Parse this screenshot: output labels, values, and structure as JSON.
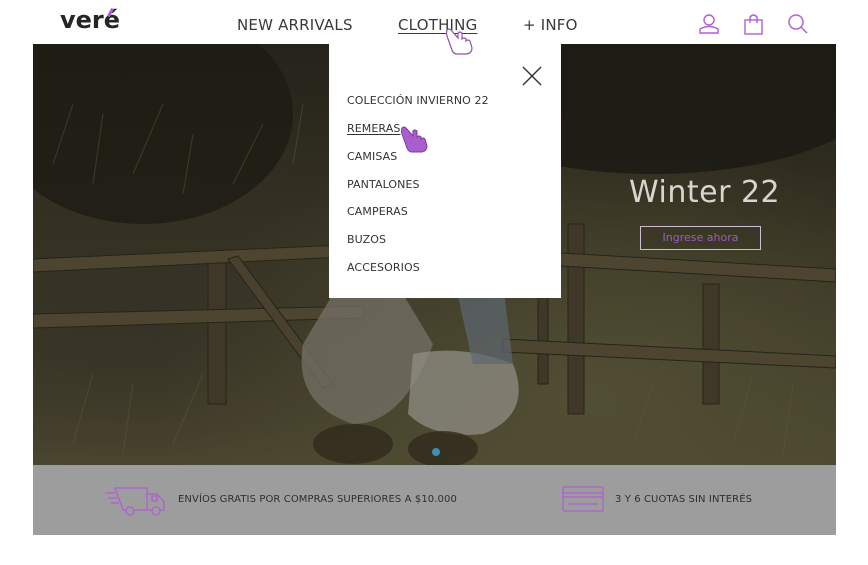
{
  "brand": {
    "logo_text": "veré",
    "accent_color": "#b05fd3"
  },
  "nav": {
    "items": [
      {
        "label": "NEW ARRIVALS"
      },
      {
        "label": "CLOTHING",
        "active": true
      },
      {
        "label": "+ INFO"
      }
    ],
    "icons": [
      "user-icon",
      "shopping-bag-icon",
      "search-icon"
    ]
  },
  "dropdown": {
    "close_icon": "close-icon",
    "items": [
      {
        "label": "COLECCIÓN INVIERNO 22"
      },
      {
        "label": "REMERAS",
        "active": true
      },
      {
        "label": "CAMISAS"
      },
      {
        "label": "PANTALONES"
      },
      {
        "label": "CAMPERAS"
      },
      {
        "label": "BUZOS"
      },
      {
        "label": "ACCESORIOS"
      }
    ]
  },
  "hero": {
    "title": "Winter 22",
    "cta_label": "Ingrese ahora",
    "cta_color": "#9b5cbf",
    "carousel": {
      "slides": 1,
      "current": 1
    }
  },
  "info_bar": {
    "shipping_text": "ENVÍOS GRATIS POR COMPRAS SUPERIORES A $10.000",
    "installments_text": "3 Y 6 CUOTAS SIN INTERÉS",
    "icons": [
      "truck-icon",
      "credit-card-icon"
    ]
  },
  "colors": {
    "info_bar_bg": "#9d9d9d",
    "icon_purple": "#b05fd3",
    "carousel_dot": "#3d8fb4"
  }
}
